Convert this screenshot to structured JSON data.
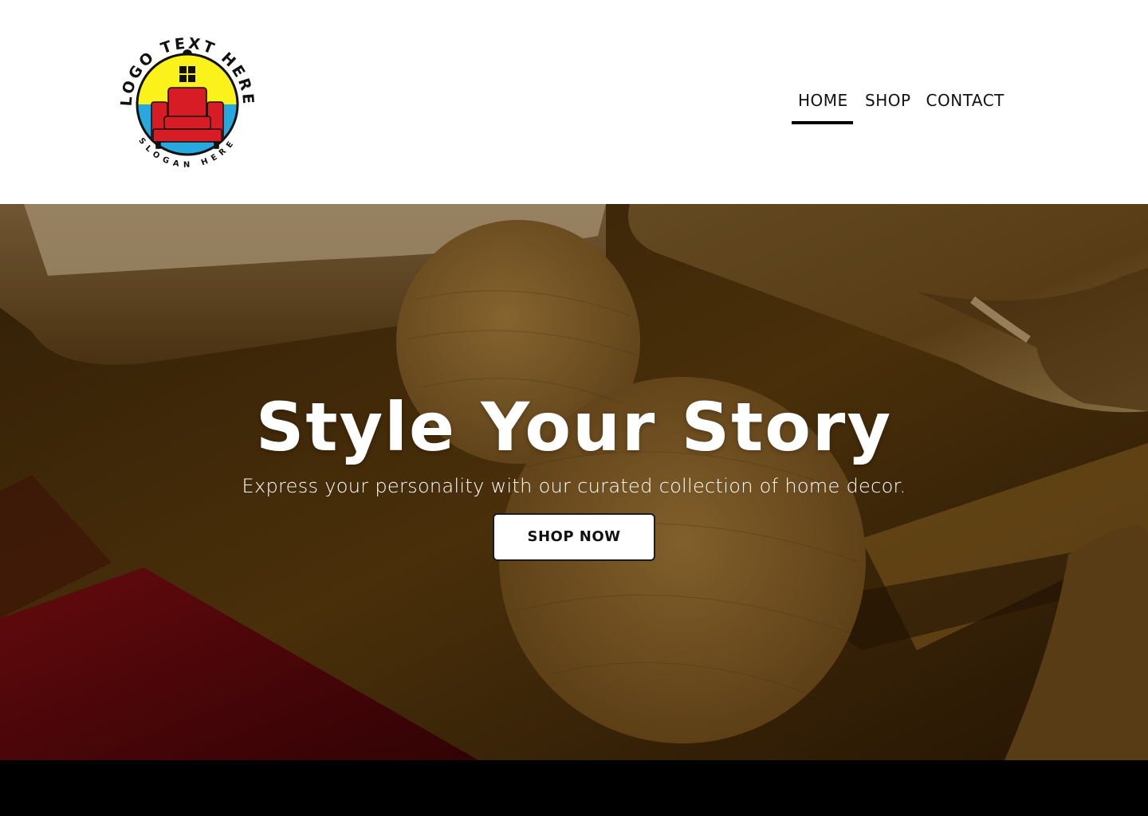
{
  "header": {
    "logo": {
      "icon": "armchair-logo-icon",
      "arc_text": "LOGO TEXT HERE",
      "slogan_text": "SLOGAN HERE",
      "colors": {
        "sky": "#fbf21c",
        "sea": "#27a9df",
        "chair": "#d81c25",
        "outline": "#111111"
      }
    },
    "nav": {
      "items": [
        {
          "label": "HOME",
          "active": true
        },
        {
          "label": "SHOP",
          "active": false
        },
        {
          "label": "CONTACT",
          "active": false
        }
      ]
    }
  },
  "hero": {
    "title": "Style Your Story",
    "subtitle": "Express your personality with our curated collection of home decor.",
    "cta_label": "SHOP NOW",
    "background": "living-room-photo-wooden-tables"
  },
  "colors": {
    "header_bg": "#ffffff",
    "nav_text": "#111111",
    "active_underline": "#000000",
    "hero_text": "#ffffff",
    "button_bg": "#ffffff",
    "footer_bg": "#000000"
  }
}
